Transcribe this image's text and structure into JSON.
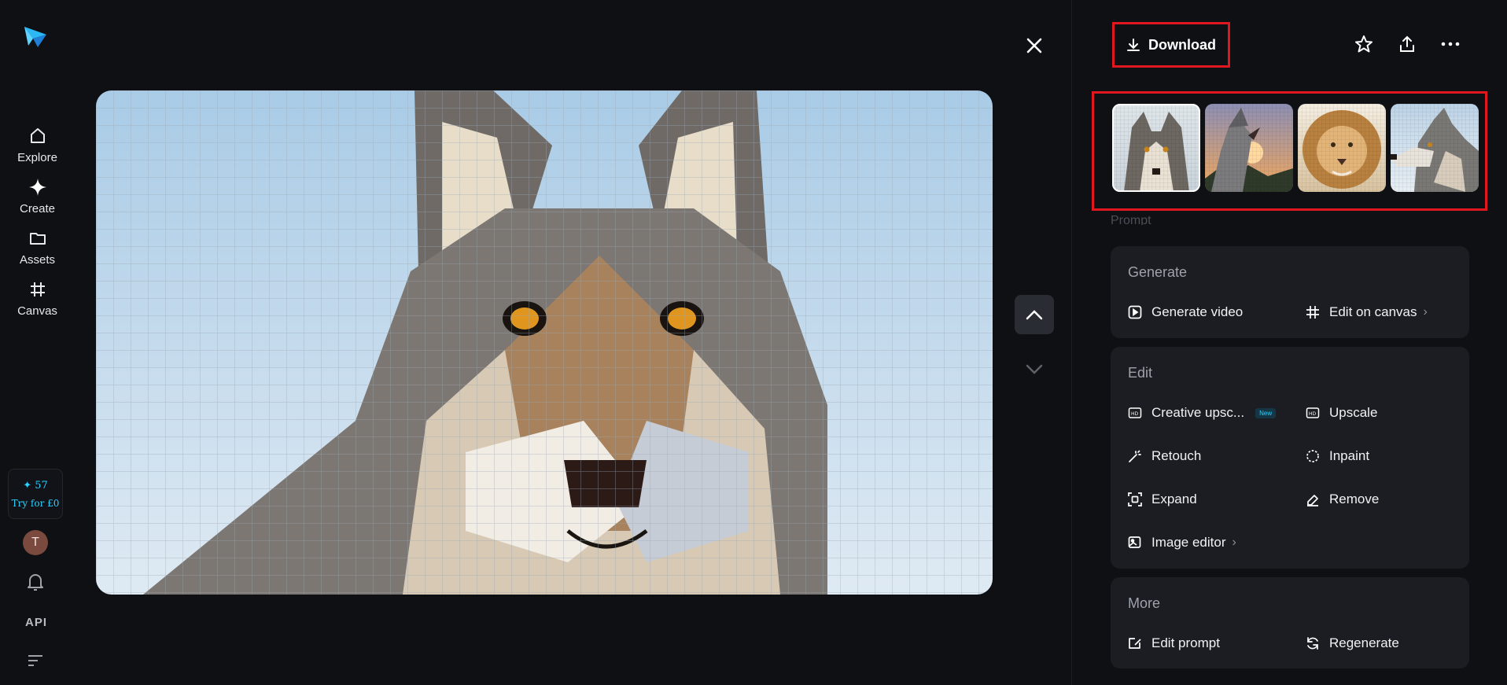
{
  "nav": {
    "items": [
      {
        "label": "Explore",
        "icon": "home-icon"
      },
      {
        "label": "Create",
        "icon": "sparkle-icon"
      },
      {
        "label": "Assets",
        "icon": "folder-icon"
      },
      {
        "label": "Canvas",
        "icon": "frame-icon"
      }
    ],
    "credits": {
      "count": "✦ 57",
      "cta": "Try for £0"
    },
    "avatar_initial": "T",
    "api_label": "API"
  },
  "viewer": {
    "image_subject": "pixel-art wolf portrait"
  },
  "panel": {
    "download_label": "Download",
    "prompt_label": "Prompt",
    "thumbnails": [
      {
        "subject": "wolf-front",
        "selected": true
      },
      {
        "subject": "wolf-howling-sunset",
        "selected": false
      },
      {
        "subject": "lion",
        "selected": false
      },
      {
        "subject": "wolf-profile",
        "selected": false
      }
    ],
    "generate": {
      "title": "Generate",
      "actions": [
        {
          "label": "Generate video",
          "icon": "play-square-icon"
        },
        {
          "label": "Edit on canvas",
          "icon": "frame-icon",
          "chevron": "›"
        }
      ]
    },
    "edit": {
      "title": "Edit",
      "actions": [
        {
          "label": "Creative upsc...",
          "icon": "hd-plus-icon",
          "badge": "New"
        },
        {
          "label": "Upscale",
          "icon": "hd-icon"
        },
        {
          "label": "Retouch",
          "icon": "magic-wand-icon"
        },
        {
          "label": "Inpaint",
          "icon": "dashed-brush-icon"
        },
        {
          "label": "Expand",
          "icon": "expand-icon"
        },
        {
          "label": "Remove",
          "icon": "eraser-icon"
        },
        {
          "label": "Image editor",
          "icon": "image-edit-icon",
          "chevron": "›"
        }
      ]
    },
    "more": {
      "title": "More",
      "actions": [
        {
          "label": "Edit prompt",
          "icon": "edit-prompt-icon"
        },
        {
          "label": "Regenerate",
          "icon": "regenerate-icon"
        }
      ]
    }
  },
  "colors": {
    "accent": "#2bd1ff",
    "highlight_box": "#e0171e",
    "bg": "#0f1014",
    "card": "#1c1d22"
  }
}
